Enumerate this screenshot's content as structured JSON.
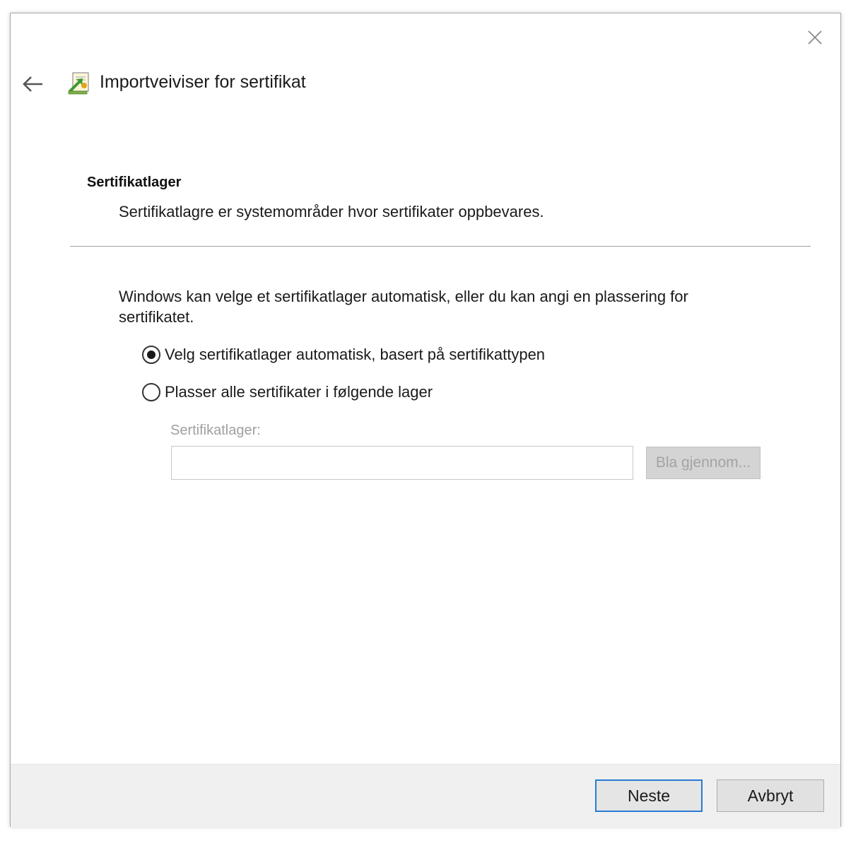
{
  "window": {
    "title": "Importveiviser for sertifikat",
    "close_icon": "close-icon",
    "back_icon": "back-arrow-icon",
    "app_icon": "certificate-wizard-icon"
  },
  "section": {
    "heading": "Sertifikatlager",
    "description": "Sertifikatlagre er systemområder hvor sertifikater oppbevares."
  },
  "content": {
    "intro": "Windows kan velge et sertifikatlager automatisk, eller du kan angi en plassering for sertifikatet.",
    "options": [
      {
        "label": "Velg sertifikatlager automatisk, basert på sertifikattypen",
        "checked": true
      },
      {
        "label": "Plasser alle sertifikater i følgende lager",
        "checked": false
      }
    ],
    "store_field": {
      "label": "Sertifikatlager:",
      "value": "",
      "disabled": true
    },
    "browse_label": "Bla gjennom..."
  },
  "footer": {
    "next_label": "Neste",
    "cancel_label": "Avbryt"
  },
  "colors": {
    "accent": "#2a7ad3",
    "footer_bg": "#f0f0f0",
    "disabled_text": "#a0a0a0"
  }
}
